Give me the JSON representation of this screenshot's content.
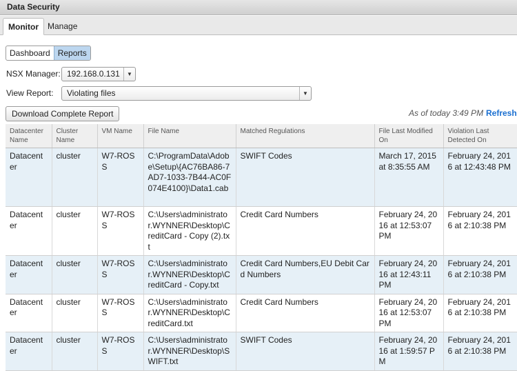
{
  "window": {
    "title": "Data Security"
  },
  "tabs": [
    {
      "label": "Monitor"
    },
    {
      "label": "Manage"
    }
  ],
  "view_toggle": {
    "dashboard": "Dashboard",
    "reports": "Reports"
  },
  "nsx": {
    "label": "NSX Manager:",
    "value": "192.168.0.131"
  },
  "report": {
    "label": "View Report:",
    "value": "Violating files"
  },
  "toolbar": {
    "download_label": "Download Complete Report",
    "as_of": "As of today 3:49 PM",
    "refresh_label": "Refresh"
  },
  "table": {
    "headers": [
      "Datacenter Name",
      "Cluster Name",
      "VM Name",
      "File Name",
      "Matched Regulations",
      "File Last Modified On",
      "Violation Last Detected On"
    ],
    "rows": [
      [
        "Datacenter",
        "cluster",
        "W7-ROSS",
        "C:\\ProgramData\\Adobe\\Setup\\{AC76BA86-7AD7-1033-7B44-AC0F074E4100}\\Data1.cab",
        "SWIFT Codes",
        "March 17, 2015 at 8:35:55 AM",
        "February 24, 2016 at 12:43:48 PM"
      ],
      [
        "Datacenter",
        "cluster",
        "W7-ROSS",
        "C:\\Users\\administrator.WYNNER\\Desktop\\CreditCard - Copy (2).txt",
        "Credit Card Numbers",
        "February 24, 2016 at 12:53:07 PM",
        "February 24, 2016 at 2:10:38 PM"
      ],
      [
        "Datacenter",
        "cluster",
        "W7-ROSS",
        "C:\\Users\\administrator.WYNNER\\Desktop\\CreditCard - Copy.txt",
        "Credit Card Numbers,EU Debit Card Numbers",
        "February 24, 2016 at 12:43:11 PM",
        "February 24, 2016 at 2:10:38 PM"
      ],
      [
        "Datacenter",
        "cluster",
        "W7-ROSS",
        "C:\\Users\\administrator.WYNNER\\Desktop\\CreditCard.txt",
        "Credit Card Numbers",
        "February 24, 2016 at 12:53:07 PM",
        "February 24, 2016 at 2:10:38 PM"
      ],
      [
        "Datacenter",
        "cluster",
        "W7-ROSS",
        "C:\\Users\\administrator.WYNNER\\Desktop\\SWIFT.txt",
        "SWIFT Codes",
        "February 24, 2016 at 1:59:57 PM",
        "February 24, 2016 at 2:10:38 PM"
      ]
    ]
  },
  "colors": {
    "accent": "#1a6fd0",
    "row_alt": "#e6f0f7",
    "toggle_on": "#bcd6ef"
  }
}
